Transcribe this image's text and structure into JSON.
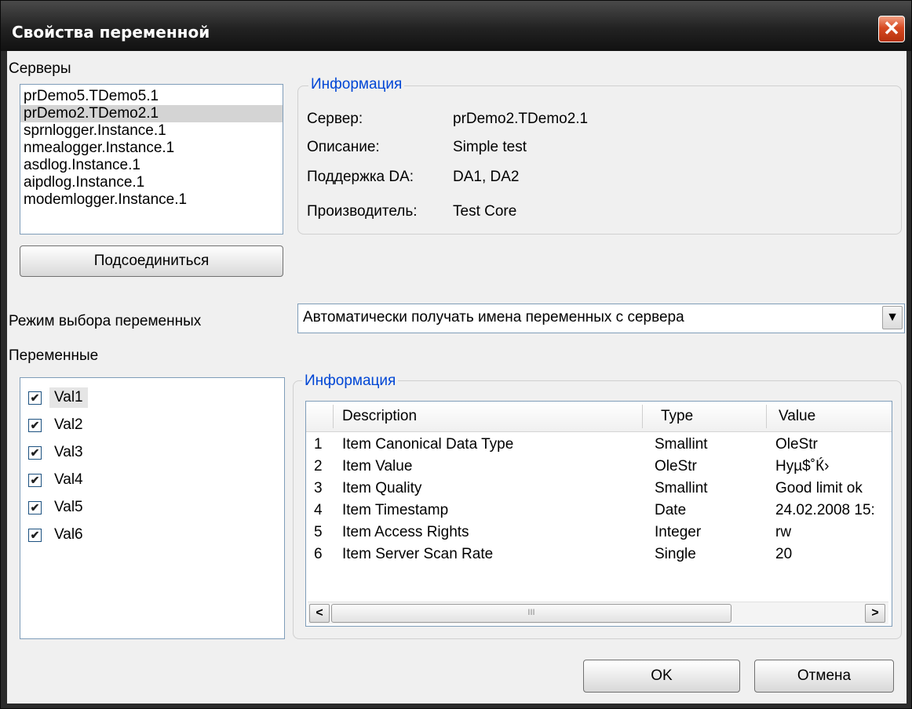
{
  "window": {
    "title": "Свойства переменной",
    "close_label": "✕"
  },
  "servers": {
    "label": "Серверы",
    "items": [
      "prDemo5.TDemo5.1",
      "prDemo2.TDemo2.1",
      "sprnlogger.Instance.1",
      "nmealogger.Instance.1",
      "asdlog.Instance.1",
      "aipdlog.Instance.1",
      "modemlogger.Instance.1"
    ],
    "selected_index": 1,
    "connect_label": "Подсоединиться"
  },
  "server_info": {
    "title": "Информация",
    "rows": [
      {
        "label": "Сервер:",
        "value": "prDemo2.TDemo2.1"
      },
      {
        "label": "Описание:",
        "value": "Simple test"
      },
      {
        "label": "Поддержка DA:",
        "value": "DA1, DA2"
      },
      {
        "label": "Производитель:",
        "value": "Test Core"
      }
    ]
  },
  "mode": {
    "label": "Режим выбора переменных",
    "selected": "Автоматически получать имена переменных с сервера"
  },
  "variables": {
    "label": "Переменные",
    "items": [
      {
        "name": "Val1",
        "checked": true
      },
      {
        "name": "Val2",
        "checked": true
      },
      {
        "name": "Val3",
        "checked": true
      },
      {
        "name": "Val4",
        "checked": true
      },
      {
        "name": "Val5",
        "checked": true
      },
      {
        "name": "Val6",
        "checked": true
      }
    ],
    "check_mark": "✔"
  },
  "item_info": {
    "title": "Информация",
    "columns": [
      "Description",
      "Type",
      "Value"
    ],
    "rows": [
      {
        "n": "1",
        "desc": "Item Canonical Data Type",
        "type": "Smallint",
        "value": "OleStr"
      },
      {
        "n": "2",
        "desc": "Item Value",
        "type": "OleStr",
        "value": "Hyµ$˚Ќ›"
      },
      {
        "n": "3",
        "desc": "Item Quality",
        "type": "Smallint",
        "value": "Good limit ok"
      },
      {
        "n": "4",
        "desc": "Item Timestamp",
        "type": "Date",
        "value": "24.02.2008 15:"
      },
      {
        "n": "5",
        "desc": "Item Access Rights",
        "type": "Integer",
        "value": "rw"
      },
      {
        "n": "6",
        "desc": "Item Server Scan Rate",
        "type": "Single",
        "value": "20"
      }
    ],
    "scroll_left": "<",
    "scroll_right": ">",
    "thumb_grip": "III"
  },
  "buttons": {
    "ok": "OK",
    "cancel": "Отмена"
  },
  "dropdown_arrow": "▼"
}
